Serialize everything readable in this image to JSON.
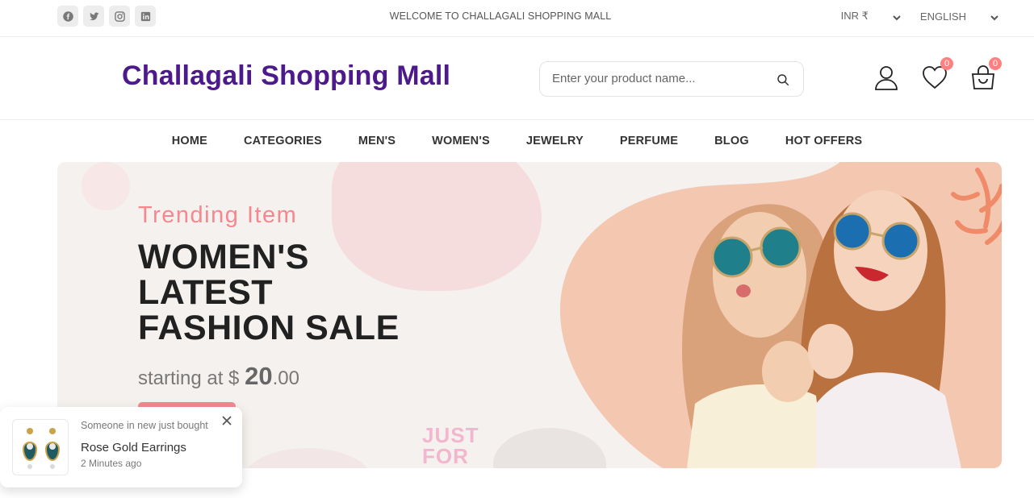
{
  "topbar": {
    "socials": [
      "facebook-icon",
      "twitter-icon",
      "instagram-icon",
      "linkedin-icon"
    ],
    "welcome": "WELCOME TO CHALLAGALI SHOPPING MALL",
    "currency": "INR ₹",
    "language": "ENGLISH"
  },
  "header": {
    "logo": "Challagali Shopping Mall",
    "search_placeholder": "Enter your product name...",
    "wishlist_count": "0",
    "cart_count": "0"
  },
  "nav": {
    "items": [
      "HOME",
      "CATEGORIES",
      "MEN'S",
      "WOMEN'S",
      "JEWELRY",
      "PERFUME",
      "BLOG",
      "HOT OFFERS"
    ]
  },
  "banner": {
    "subtitle": "Trending Item",
    "headline_1": "WOMEN'S",
    "headline_2": "LATEST",
    "headline_3": "FASHION SALE",
    "price_prefix": "starting at $",
    "price_whole": "20",
    "price_cents": ".00",
    "sticker_1": "JUST",
    "sticker_2": "FOR"
  },
  "toast": {
    "line1": "Someone in new just bought",
    "product": "Rose Gold Earrings",
    "time": "2 Minutes ago"
  },
  "colors": {
    "brand": "#4d1a8c",
    "accent": "#f3888f",
    "badge": "#ff8080"
  }
}
